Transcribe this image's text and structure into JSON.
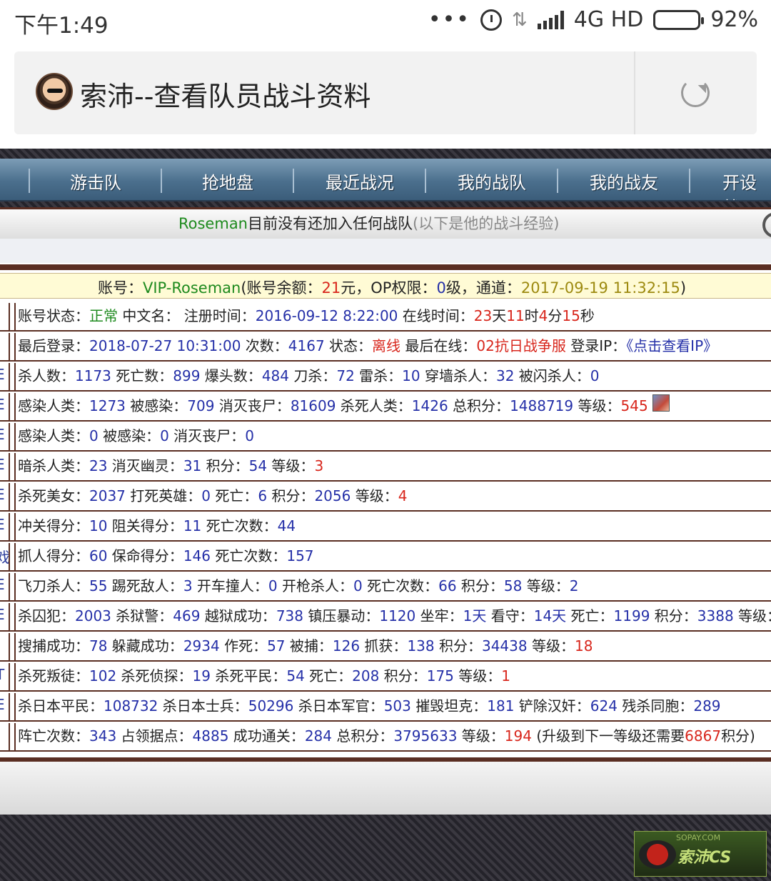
{
  "status_bar": {
    "time": "下午1:49",
    "dots": "•••",
    "network": "4G HD",
    "battery_percent": "92%",
    "battery_level": 0.92
  },
  "browser": {
    "page_title": "索沛--查看队员战斗资料"
  },
  "nav": {
    "items": [
      "游击队",
      "抢地盘",
      "最近战况",
      "我的战队",
      "我的战友",
      "开设战"
    ]
  },
  "notice": {
    "name": "Roseman",
    "text": "目前没有还加入任何战队",
    "hint": "(以下是他的战斗经验)"
  },
  "account": {
    "label": "账号：",
    "id": "VIP-Roseman",
    "balance_label": "(账号余额：",
    "balance": "21",
    "unit": "元，OP权限：",
    "op_level": "0",
    "op_unit": "级，通道：",
    "channel_time": "2017-09-19 11:32:15",
    "close": ")"
  },
  "rows": [
    {
      "left_char": "",
      "parts": [
        {
          "t": "账号状态：",
          "c": ""
        },
        {
          "t": "正常",
          "c": "g"
        },
        {
          "t": " 中文名： 注册时间：",
          "c": ""
        },
        {
          "t": "2016-09-12 8:22:00",
          "c": "n"
        },
        {
          "t": " 在线时间：",
          "c": ""
        },
        {
          "t": "23",
          "c": "r"
        },
        {
          "t": "天",
          "c": ""
        },
        {
          "t": "11",
          "c": "r"
        },
        {
          "t": "时",
          "c": ""
        },
        {
          "t": "4",
          "c": "r"
        },
        {
          "t": "分",
          "c": ""
        },
        {
          "t": "15",
          "c": "r"
        },
        {
          "t": "秒",
          "c": ""
        }
      ]
    },
    {
      "left_char": "",
      "parts": [
        {
          "t": "最后登录：",
          "c": ""
        },
        {
          "t": "2018-07-27 10:31:00",
          "c": "n"
        },
        {
          "t": " 次数：",
          "c": ""
        },
        {
          "t": "4167",
          "c": "n"
        },
        {
          "t": " 状态：",
          "c": ""
        },
        {
          "t": "离线",
          "c": "r"
        },
        {
          "t": " 最后在线：",
          "c": ""
        },
        {
          "t": "02抗日战争服",
          "c": "r"
        },
        {
          "t": " 登录IP：",
          "c": ""
        },
        {
          "t": "《点击查看IP》",
          "c": "lnk"
        }
      ]
    },
    {
      "left_char": "E",
      "parts": [
        {
          "t": "杀人数：",
          "c": ""
        },
        {
          "t": "1173",
          "c": "n"
        },
        {
          "t": " 死亡数：",
          "c": ""
        },
        {
          "t": "899",
          "c": "n"
        },
        {
          "t": " 爆头数：",
          "c": ""
        },
        {
          "t": "484",
          "c": "n"
        },
        {
          "t": " 刀杀：",
          "c": ""
        },
        {
          "t": "72",
          "c": "n"
        },
        {
          "t": " 雷杀：",
          "c": ""
        },
        {
          "t": "10",
          "c": "n"
        },
        {
          "t": " 穿墙杀人：",
          "c": ""
        },
        {
          "t": "32",
          "c": "n"
        },
        {
          "t": " 被闪杀人：",
          "c": ""
        },
        {
          "t": "0",
          "c": "n"
        }
      ]
    },
    {
      "left_char": "E",
      "avatar": true,
      "parts": [
        {
          "t": "感染人类：",
          "c": ""
        },
        {
          "t": "1273",
          "c": "n"
        },
        {
          "t": " 被感染：",
          "c": ""
        },
        {
          "t": "709",
          "c": "n"
        },
        {
          "t": " 消灭丧尸：",
          "c": ""
        },
        {
          "t": "81609",
          "c": "n"
        },
        {
          "t": " 杀死人类：",
          "c": ""
        },
        {
          "t": "1426",
          "c": "n"
        },
        {
          "t": " 总积分：",
          "c": ""
        },
        {
          "t": "1488719",
          "c": "n"
        },
        {
          "t": " 等级：",
          "c": ""
        },
        {
          "t": "545",
          "c": "r"
        }
      ]
    },
    {
      "left_char": "E",
      "parts": [
        {
          "t": "感染人类：",
          "c": ""
        },
        {
          "t": "0",
          "c": "n"
        },
        {
          "t": " 被感染：",
          "c": ""
        },
        {
          "t": "0",
          "c": "n"
        },
        {
          "t": " 消灭丧尸：",
          "c": ""
        },
        {
          "t": "0",
          "c": "n"
        }
      ]
    },
    {
      "left_char": "E",
      "parts": [
        {
          "t": "暗杀人类：",
          "c": ""
        },
        {
          "t": "23",
          "c": "n"
        },
        {
          "t": " 消灭幽灵：",
          "c": ""
        },
        {
          "t": "31",
          "c": "n"
        },
        {
          "t": " 积分：",
          "c": ""
        },
        {
          "t": "54",
          "c": "n"
        },
        {
          "t": " 等级：",
          "c": ""
        },
        {
          "t": "3",
          "c": "r"
        }
      ]
    },
    {
      "left_char": "E",
      "parts": [
        {
          "t": "杀死美女：",
          "c": ""
        },
        {
          "t": "2037",
          "c": "n"
        },
        {
          "t": " 打死英雄：",
          "c": ""
        },
        {
          "t": "0",
          "c": "n"
        },
        {
          "t": " 死亡：",
          "c": ""
        },
        {
          "t": "6",
          "c": "n"
        },
        {
          "t": " 积分：",
          "c": ""
        },
        {
          "t": "2056",
          "c": "n"
        },
        {
          "t": " 等级：",
          "c": ""
        },
        {
          "t": "4",
          "c": "r"
        }
      ]
    },
    {
      "left_char": "E",
      "parts": [
        {
          "t": "冲关得分：",
          "c": ""
        },
        {
          "t": "10",
          "c": "n"
        },
        {
          "t": " 阻关得分：",
          "c": ""
        },
        {
          "t": "11",
          "c": "n"
        },
        {
          "t": " 死亡次数：",
          "c": ""
        },
        {
          "t": "44",
          "c": "n"
        }
      ]
    },
    {
      "left_char": "戏",
      "parts": [
        {
          "t": "抓人得分：",
          "c": ""
        },
        {
          "t": "60",
          "c": "n"
        },
        {
          "t": " 保命得分：",
          "c": ""
        },
        {
          "t": "146",
          "c": "n"
        },
        {
          "t": " 死亡次数：",
          "c": ""
        },
        {
          "t": "157",
          "c": "n"
        }
      ]
    },
    {
      "left_char": "E",
      "parts": [
        {
          "t": "飞刀杀人：",
          "c": ""
        },
        {
          "t": "55",
          "c": "n"
        },
        {
          "t": " 踢死敌人：",
          "c": ""
        },
        {
          "t": "3",
          "c": "n"
        },
        {
          "t": " 开车撞人：",
          "c": ""
        },
        {
          "t": "0",
          "c": "n"
        },
        {
          "t": " 开枪杀人：",
          "c": ""
        },
        {
          "t": "0",
          "c": "n"
        },
        {
          "t": " 死亡次数：",
          "c": ""
        },
        {
          "t": "66",
          "c": "n"
        },
        {
          "t": " 积分：",
          "c": ""
        },
        {
          "t": "58",
          "c": "n"
        },
        {
          "t": " 等级：",
          "c": ""
        },
        {
          "t": "2",
          "c": "n"
        }
      ]
    },
    {
      "left_char": "E",
      "parts": [
        {
          "t": "杀囚犯：",
          "c": ""
        },
        {
          "t": "2003",
          "c": "n"
        },
        {
          "t": " 杀狱警：",
          "c": ""
        },
        {
          "t": "469",
          "c": "n"
        },
        {
          "t": " 越狱成功：",
          "c": ""
        },
        {
          "t": "738",
          "c": "n"
        },
        {
          "t": " 镇压暴动：",
          "c": ""
        },
        {
          "t": "1120",
          "c": "n"
        },
        {
          "t": " 坐牢：",
          "c": ""
        },
        {
          "t": "1天",
          "c": "n"
        },
        {
          "t": " 看守：",
          "c": ""
        },
        {
          "t": "14天",
          "c": "n"
        },
        {
          "t": " 死亡：",
          "c": ""
        },
        {
          "t": "1199",
          "c": "n"
        },
        {
          "t": " 积分：",
          "c": ""
        },
        {
          "t": "3388",
          "c": "n"
        },
        {
          "t": " 等级：",
          "c": ""
        },
        {
          "t": "18",
          "c": "r"
        }
      ]
    },
    {
      "left_char": "i",
      "parts": [
        {
          "t": "搜捕成功：",
          "c": ""
        },
        {
          "t": "78",
          "c": "n"
        },
        {
          "t": " 躲藏成功：",
          "c": ""
        },
        {
          "t": "2934",
          "c": "n"
        },
        {
          "t": " 作死：",
          "c": ""
        },
        {
          "t": "57",
          "c": "n"
        },
        {
          "t": " 被捕：",
          "c": ""
        },
        {
          "t": "126",
          "c": "n"
        },
        {
          "t": " 抓获：",
          "c": ""
        },
        {
          "t": "138",
          "c": "n"
        },
        {
          "t": " 积分：",
          "c": ""
        },
        {
          "t": "34438",
          "c": "n"
        },
        {
          "t": " 等级：",
          "c": ""
        },
        {
          "t": "18",
          "c": "r"
        }
      ]
    },
    {
      "left_char": "T",
      "parts": [
        {
          "t": "杀死叛徒：",
          "c": ""
        },
        {
          "t": "102",
          "c": "n"
        },
        {
          "t": " 杀死侦探：",
          "c": ""
        },
        {
          "t": "19",
          "c": "n"
        },
        {
          "t": " 杀死平民：",
          "c": ""
        },
        {
          "t": "54",
          "c": "n"
        },
        {
          "t": " 死亡：",
          "c": ""
        },
        {
          "t": "208",
          "c": "n"
        },
        {
          "t": " 积分：",
          "c": ""
        },
        {
          "t": "175",
          "c": "n"
        },
        {
          "t": " 等级：",
          "c": ""
        },
        {
          "t": "1",
          "c": "r"
        }
      ]
    },
    {
      "left_char": "E",
      "parts": [
        {
          "t": "杀日本平民：",
          "c": ""
        },
        {
          "t": "108732",
          "c": "n"
        },
        {
          "t": " 杀日本士兵：",
          "c": ""
        },
        {
          "t": "50296",
          "c": "n"
        },
        {
          "t": " 杀日本军官：",
          "c": ""
        },
        {
          "t": "503",
          "c": "n"
        },
        {
          "t": " 摧毁坦克：",
          "c": ""
        },
        {
          "t": "181",
          "c": "n"
        },
        {
          "t": " 铲除汉奸：",
          "c": ""
        },
        {
          "t": "624",
          "c": "n"
        },
        {
          "t": " 残杀同胞：",
          "c": ""
        },
        {
          "t": "289",
          "c": "n"
        }
      ]
    },
    {
      "left_char": "",
      "parts": [
        {
          "t": "阵亡次数：",
          "c": ""
        },
        {
          "t": "343",
          "c": "n"
        },
        {
          "t": " 占领据点：",
          "c": ""
        },
        {
          "t": "4885",
          "c": "n"
        },
        {
          "t": " 成功通关：",
          "c": ""
        },
        {
          "t": "284",
          "c": "n"
        },
        {
          "t": " 总积分：",
          "c": ""
        },
        {
          "t": "3795633",
          "c": "n"
        },
        {
          "t": " 等级：",
          "c": ""
        },
        {
          "t": "194",
          "c": "r"
        },
        {
          "t": " (升级到下一等级还需要",
          "c": ""
        },
        {
          "t": "6867",
          "c": "r"
        },
        {
          "t": "积分)",
          "c": ""
        }
      ]
    }
  ],
  "watermark": {
    "sub": "SOPAY.COM",
    "text": "索沛CS"
  }
}
